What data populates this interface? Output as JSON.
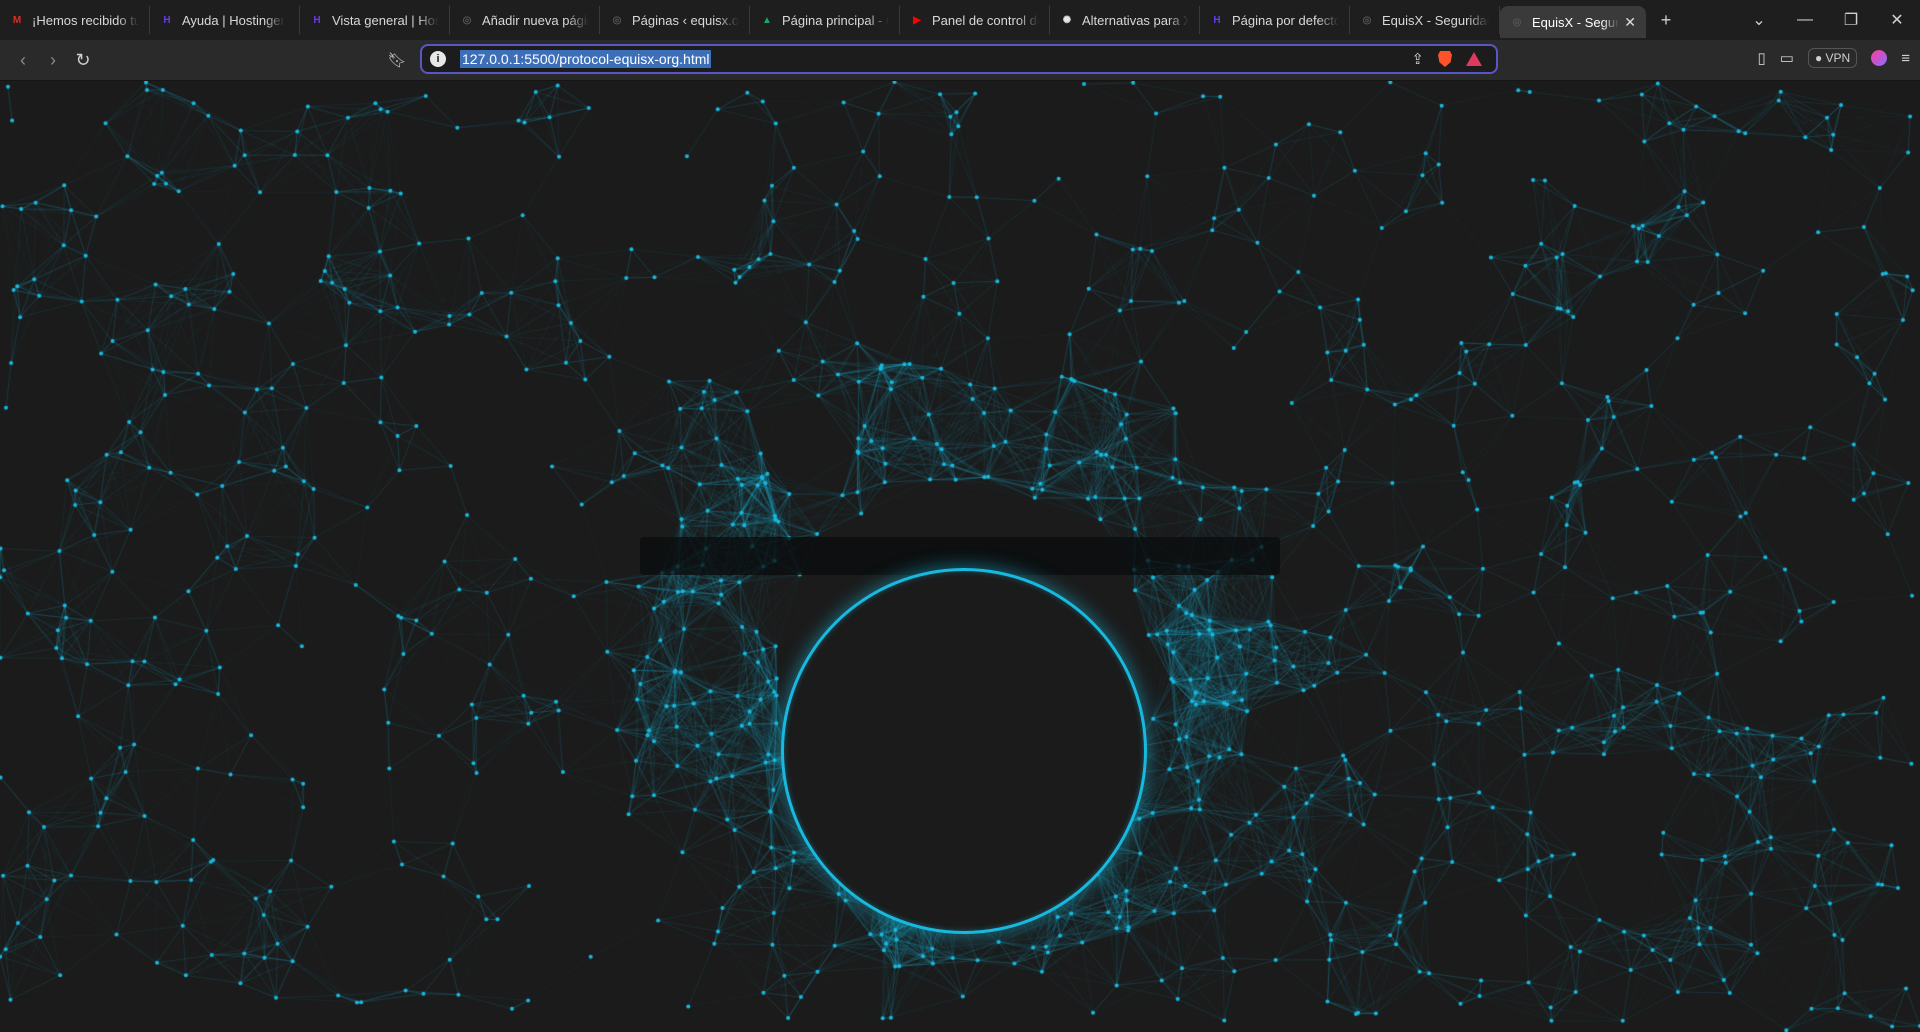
{
  "browser": {
    "tabs": [
      {
        "title": "¡Hemos recibido tu",
        "icon": "gmail-icon",
        "color": "#d93025",
        "glyph": "M"
      },
      {
        "title": "Ayuda | Hostinger",
        "icon": "hostinger-icon",
        "color": "#673de6",
        "glyph": "H"
      },
      {
        "title": "Vista general | Host",
        "icon": "hostinger-icon",
        "color": "#673de6",
        "glyph": "H"
      },
      {
        "title": "Añadir nueva págin",
        "icon": "globe-icon",
        "color": "#555555",
        "glyph": "◎"
      },
      {
        "title": "Páginas ‹ equisx.org",
        "icon": "globe-icon",
        "color": "#555555",
        "glyph": "◎"
      },
      {
        "title": "Página principal - G",
        "icon": "google-drive-icon",
        "color": "#1fa463",
        "glyph": "▲"
      },
      {
        "title": "Panel de control de",
        "icon": "youtube-icon",
        "color": "#ff0000",
        "glyph": "▶"
      },
      {
        "title": "Alternativas para X",
        "icon": "chatgpt-icon",
        "color": "#e6e6e6",
        "glyph": "✺"
      },
      {
        "title": "Página por defecto",
        "icon": "hostinger-icon",
        "color": "#673de6",
        "glyph": "H"
      },
      {
        "title": "EquisX - Seguridad",
        "icon": "globe-icon",
        "color": "#555555",
        "glyph": "◎"
      },
      {
        "title": "EquisX - Segur",
        "icon": "globe-icon",
        "color": "#555555",
        "glyph": "◎",
        "active": true
      }
    ],
    "url": "127.0.0.1:5500/protocol-equisx-org.html",
    "vpn_label": "VPN"
  },
  "colors": {
    "accent": "#19b9df",
    "background": "#1b1b1b"
  }
}
